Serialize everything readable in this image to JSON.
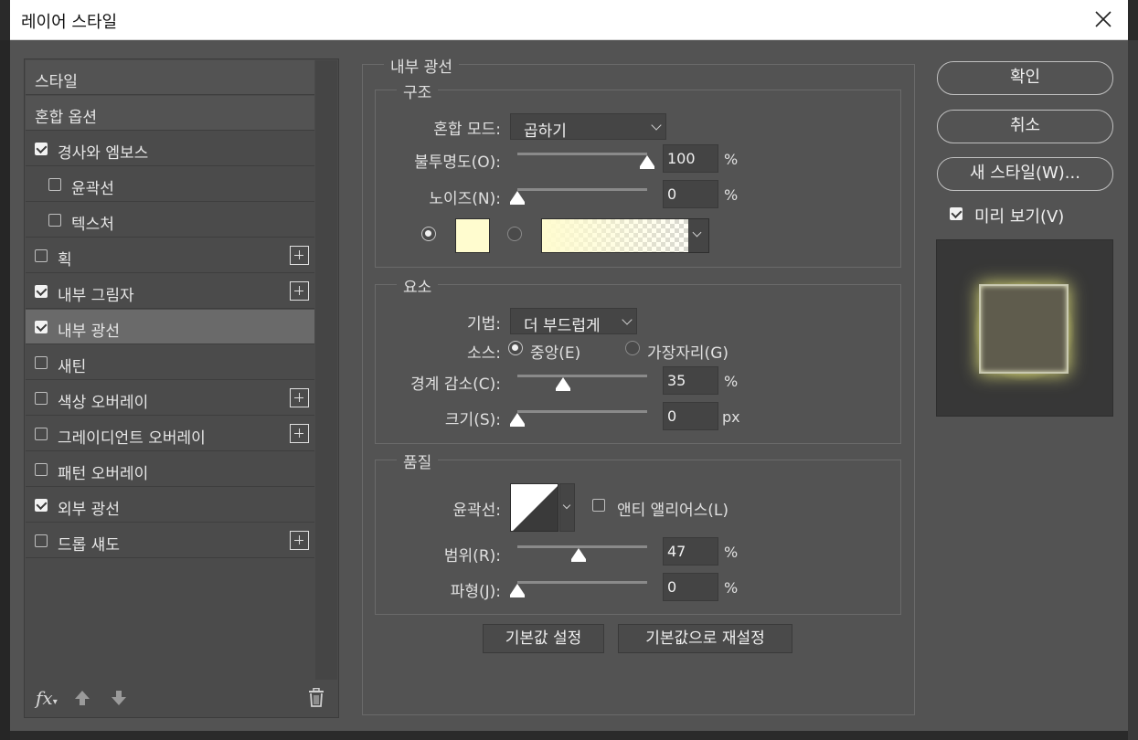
{
  "window": {
    "title": "레이어 스타일"
  },
  "styles_list": [
    {
      "label": "스타일",
      "type": "header"
    },
    {
      "label": "혼합 옵션",
      "type": "header"
    },
    {
      "label": "경사와 엠보스",
      "checked": true
    },
    {
      "label": "윤곽선",
      "checked": false,
      "indent": true
    },
    {
      "label": "텍스처",
      "checked": false,
      "indent": true
    },
    {
      "label": "획",
      "checked": false,
      "plus": true
    },
    {
      "label": "내부 그림자",
      "checked": true,
      "plus": true
    },
    {
      "label": "내부 광선",
      "checked": true,
      "selected": true
    },
    {
      "label": "새틴",
      "checked": false
    },
    {
      "label": "색상 오버레이",
      "checked": false,
      "plus": true
    },
    {
      "label": "그레이디언트 오버레이",
      "checked": false,
      "plus": true
    },
    {
      "label": "패턴 오버레이",
      "checked": false
    },
    {
      "label": "외부 광선",
      "checked": true
    },
    {
      "label": "드롭 섀도",
      "checked": false,
      "plus": true
    }
  ],
  "footer": {
    "fx_label": "fx"
  },
  "panel": {
    "title": "내부 광선",
    "structure": {
      "legend": "구조",
      "blend_mode_label": "혼합 모드:",
      "blend_mode_value": "곱하기",
      "opacity_label": "불투명도(O):",
      "opacity_value": "100",
      "opacity_pct": 1.0,
      "noise_label": "노이즈(N):",
      "noise_value": "0",
      "noise_pct": 0.0,
      "percent": "%",
      "color": "#fffccf"
    },
    "elements": {
      "legend": "요소",
      "technique_label": "기법:",
      "technique_value": "더 부드럽게",
      "source_label": "소스:",
      "source_center": "중앙(E)",
      "source_edge": "가장자리(G)",
      "choke_label": "경계 감소(C):",
      "choke_value": "35",
      "choke_pct": 0.35,
      "size_label": "크기(S):",
      "size_value": "0",
      "size_pct": 0.0,
      "px": "px"
    },
    "quality": {
      "legend": "품질",
      "contour_label": "윤곽선:",
      "antialias_label": "앤티 앨리어스(L)",
      "range_label": "범위(R):",
      "range_value": "47",
      "range_pct": 0.47,
      "jitter_label": "파형(J):",
      "jitter_value": "0",
      "jitter_pct": 0.0
    },
    "make_default": "기본값 설정",
    "reset_default": "기본값으로 재설정"
  },
  "buttons": {
    "ok": "확인",
    "cancel": "취소",
    "new_style": "새 스타일(W)...",
    "preview_label": "미리 보기(V)"
  },
  "colors": {
    "dialog_bg": "#535353",
    "glow": "#fffccf",
    "accent": "#f0f0f0"
  }
}
